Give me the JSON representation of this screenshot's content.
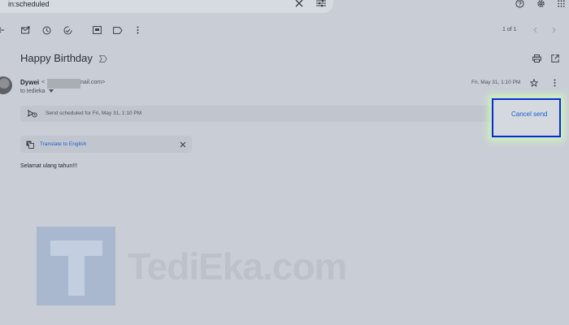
{
  "search": {
    "query": "in:scheduled"
  },
  "toolbar": {
    "range": "1 of 1"
  },
  "message": {
    "subject": "Happy Birthday",
    "sender_name": "Dywei",
    "sender_email_prefix": "<",
    "sender_email_suffix": "nail.com>",
    "recipient": "to tedieka",
    "date": "Fri, May 31, 1:10 PM",
    "body": "Selamat ulang tahun!!!"
  },
  "schedule": {
    "text": "Send scheduled for Fri, May 31, 1:10 PM",
    "cancel_label": "Cancel send"
  },
  "translate": {
    "label": "Translate to English"
  },
  "watermark": {
    "text": "TediEka.com"
  },
  "icons": {
    "search_clear": "close-icon",
    "search_options": "tune-icon",
    "help": "help-icon",
    "settings": "gear-icon",
    "apps": "apps-grid-icon"
  },
  "colors": {
    "accent": "#1a5fd0",
    "highlight_border": "#0a2ad6",
    "glow": "#cdf7b7"
  }
}
